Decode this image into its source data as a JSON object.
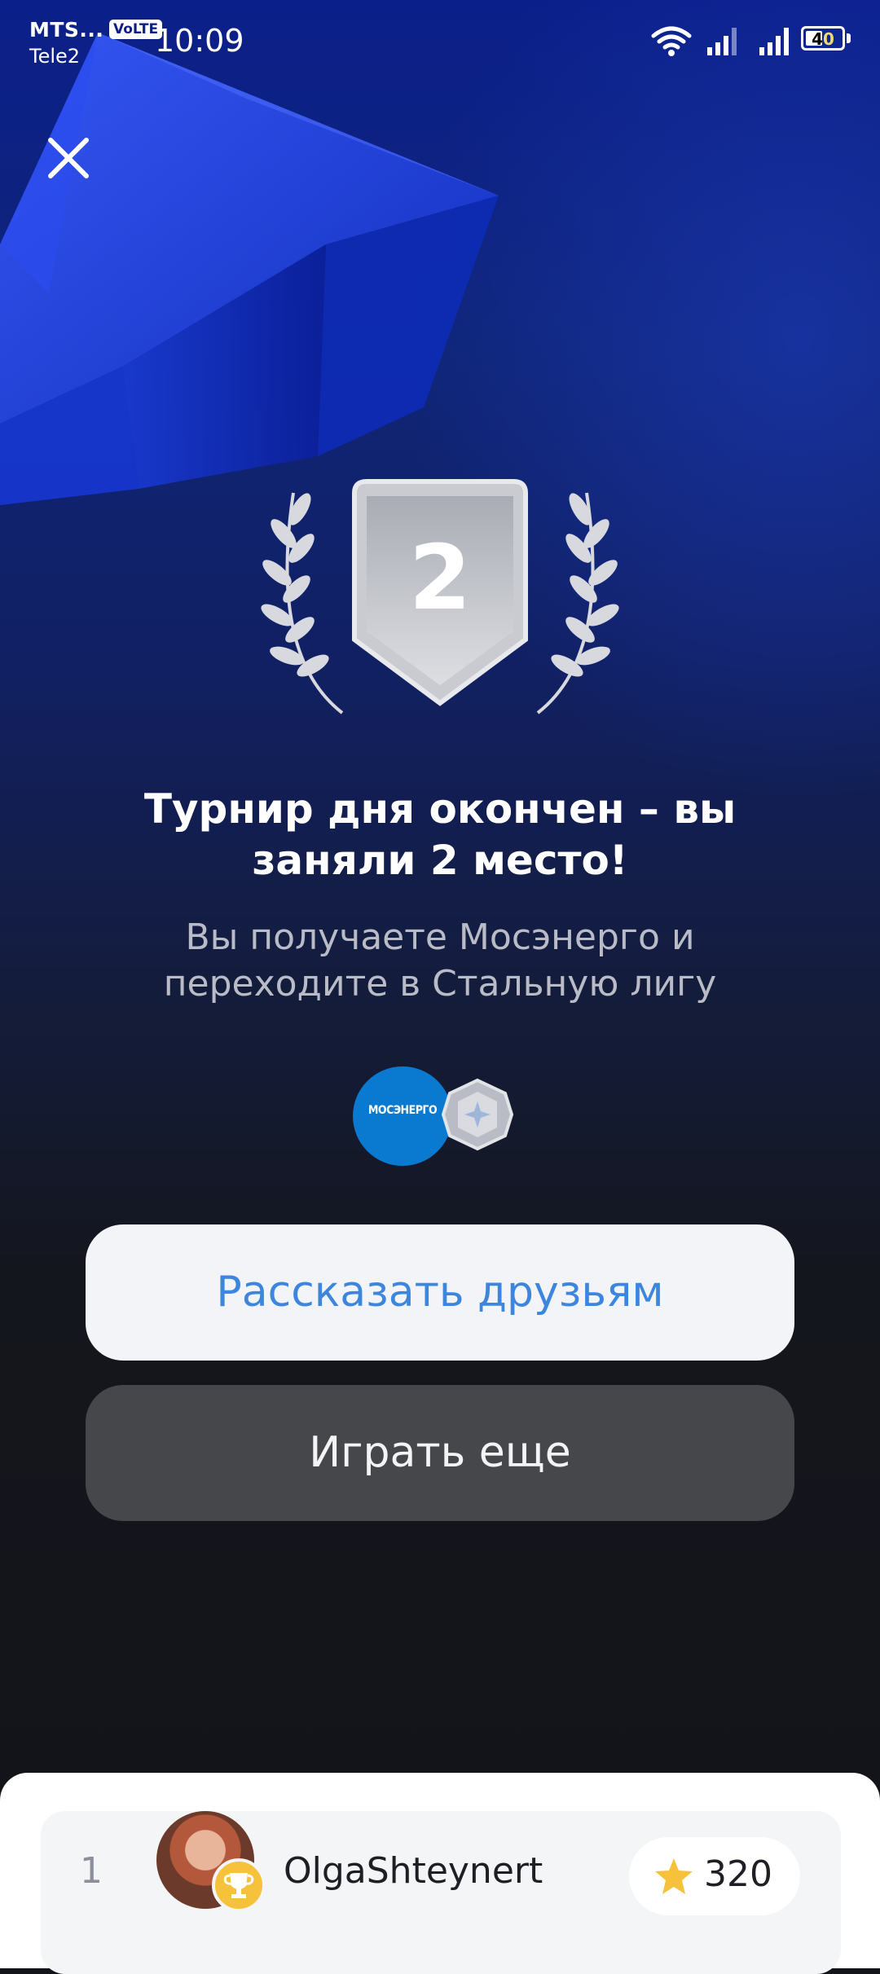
{
  "status_bar": {
    "carrier_primary": "MTS...",
    "carrier_secondary": "Tele2",
    "volte": "VoLTE",
    "time": "10:09",
    "battery": "40"
  },
  "result": {
    "place": "2",
    "title": "Турнир дня окончен – вы заняли 2 место!",
    "subtitle": "Вы получаете Мосэнерго и переходите в Стальную лигу",
    "reward_logo_text": "МОСЭНЕРГО"
  },
  "buttons": {
    "share": "Рассказать друзьям",
    "play_again": "Играть еще"
  },
  "leaderboard": {
    "rows": [
      {
        "rank": "1",
        "username": "OlgaShteynert",
        "score": "320"
      }
    ]
  },
  "colors": {
    "accent": "#3d86de",
    "star": "#f6c23c",
    "badge_silver": "#c9cbd1"
  }
}
